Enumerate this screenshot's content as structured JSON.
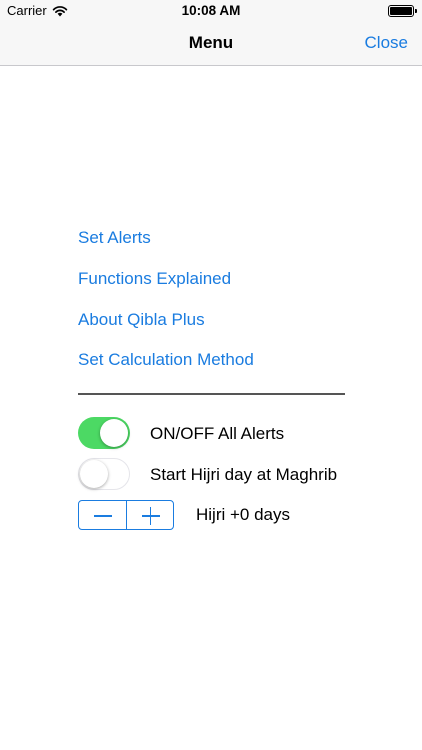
{
  "status_bar": {
    "carrier": "Carrier",
    "time": "10:08 AM",
    "icons": [
      "wifi-icon",
      "battery-icon"
    ]
  },
  "nav": {
    "title": "Menu",
    "close_label": "Close"
  },
  "menu_items": [
    {
      "label": "Set Alerts"
    },
    {
      "label": "Functions Explained"
    },
    {
      "label": "About Qibla Plus"
    },
    {
      "label": "Set Calculation Method"
    }
  ],
  "toggles": [
    {
      "label": "ON/OFF All Alerts",
      "state": "on"
    },
    {
      "label": "Start Hijri day at Maghrib",
      "state": "off"
    }
  ],
  "hijri_adjust": {
    "label": "Hijri +0 days",
    "icons": [
      "minus-icon",
      "plus-icon"
    ]
  },
  "colors": {
    "accent": "#1a7ce0",
    "switch_on": "#4cd964",
    "bar_background": "#f7f7f7"
  }
}
